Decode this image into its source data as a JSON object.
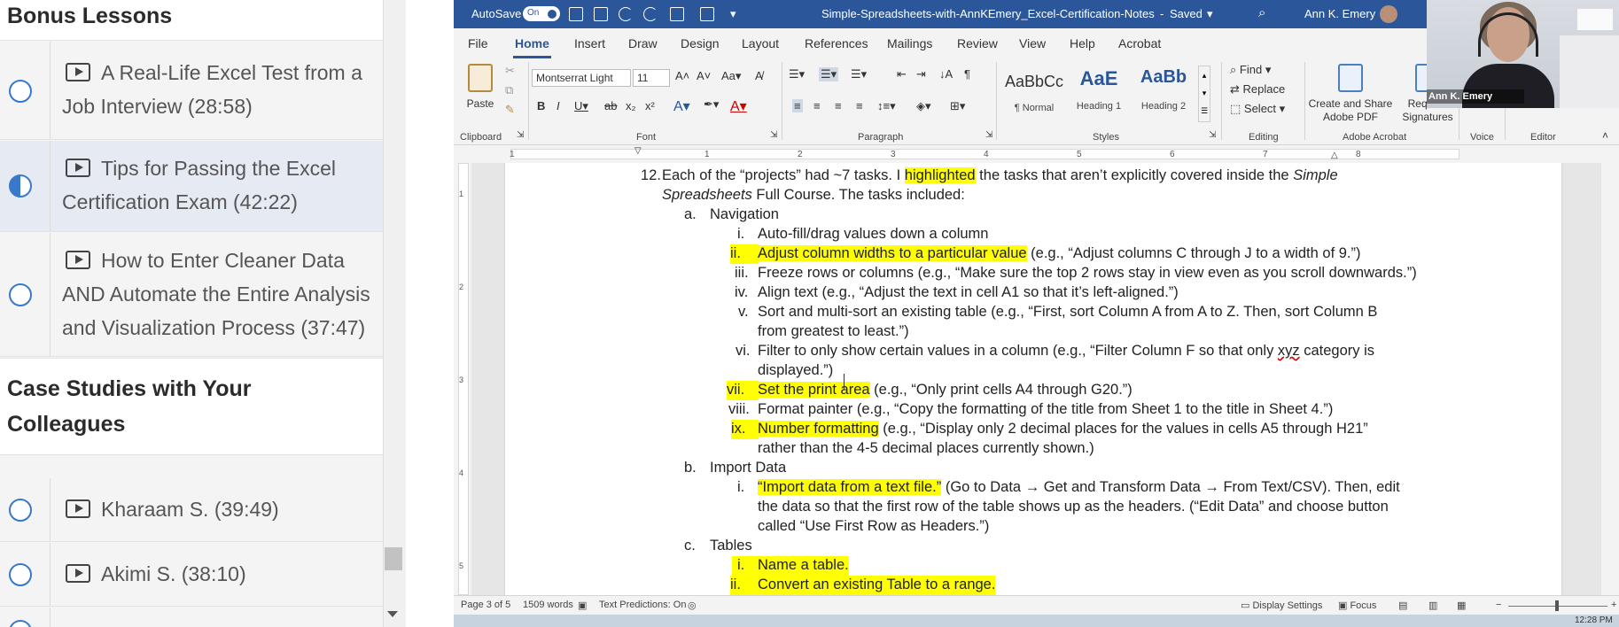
{
  "sidebar": {
    "section1_title": "Bonus Lessons",
    "lessons1": [
      {
        "l1": "A Real-Life Excel Test from a",
        "l2": "Job Interview (28:58)"
      },
      {
        "l1": "Tips for Passing the Excel",
        "l2": "Certification Exam (42:22)"
      },
      {
        "l1": "How to Enter Cleaner Data",
        "l2": "AND Automate the Entire Analysis",
        "l3": "and Visualization Process (37:47)"
      }
    ],
    "section2_title_l1": "Case Studies with Your",
    "section2_title_l2": "Colleagues",
    "lessons2": [
      {
        "l1": "Kharaam S. (39:49)"
      },
      {
        "l1": "Akimi S. (38:10)"
      }
    ]
  },
  "titlebar": {
    "autosave": "AutoSave",
    "toggle": "On",
    "doc_title": "Simple-Spreadsheets-with-AnnKEmery_Excel-Certification-Notes",
    "saved": "Saved",
    "user": "Ann K. Emery"
  },
  "menu": [
    "File",
    "Home",
    "Insert",
    "Draw",
    "Design",
    "Layout",
    "References",
    "Mailings",
    "Review",
    "View",
    "Help",
    "Acrobat"
  ],
  "ribbon": {
    "paste": "Paste",
    "font_name": "Montserrat Light",
    "font_size": "11",
    "groups": {
      "clipboard": "Clipboard",
      "font": "Font",
      "paragraph": "Paragraph",
      "styles": "Styles",
      "editing": "Editing",
      "acrobat": "Adobe Acrobat",
      "voice": "Voice",
      "editor": "Editor"
    },
    "styles": [
      {
        "preview": "AaBbCc",
        "name": "¶ Normal"
      },
      {
        "preview": "AaE",
        "name": "Heading 1"
      },
      {
        "preview": "AaBb",
        "name": "Heading 2"
      }
    ],
    "find": "Find",
    "replace": "Replace",
    "select": "Select",
    "create_share_1": "Create and Share",
    "create_share_2": "Adobe PDF",
    "request_1": "Request",
    "request_2": "Signatures"
  },
  "ruler_numbers": [
    "1",
    "1",
    "2",
    "3",
    "4",
    "5",
    "6",
    "7",
    "8"
  ],
  "vruler_numbers": [
    "1",
    "2",
    "3",
    "4",
    "5"
  ],
  "doc": {
    "item12_num": "12.",
    "item12_a": "Each of the “projects” had ~7 tasks. I ",
    "item12_hl": "highlighted",
    "item12_b": " the tasks that aren’t explicitly covered inside the ",
    "item12_it": "Simple",
    "item12_l2_it": "Spreadsheets",
    "item12_l2": " Full Course. The tasks included:",
    "a_num": "a.",
    "a_title": "Navigation",
    "nav": [
      {
        "num": "i.",
        "hl": false,
        "text": "Auto-fill/drag values down a column"
      },
      {
        "num": "ii.",
        "hl": true,
        "text": "Adjust column widths to a particular value",
        "rest": " (e.g., “Adjust columns C through J to a width of 9.”)"
      },
      {
        "num": "iii.",
        "hl": false,
        "text": "Freeze rows or columns (e.g., “Make sure the top 2 rows stay in view even as you scroll downwards.”)"
      },
      {
        "num": "iv.",
        "hl": false,
        "text": "Align text (e.g., “Adjust the text in cell A1 so that it’s left-aligned.”)"
      },
      {
        "num": "v.",
        "hl": false,
        "text": "Sort and multi-sort an existing table (e.g., “First, sort Column A from A to Z. Then, sort Column B",
        "l2": "from greatest to least.”)"
      },
      {
        "num": "vi.",
        "hl": false,
        "text": "Filter to only show certain values in a column (e.g., “Filter Column F so that only ",
        "sq": "xyz",
        "after": " category is",
        "l2": "displayed.”)"
      },
      {
        "num": "vii.",
        "hl": true,
        "text": "Set the print area",
        "rest": " (e.g., “Only print cells A4 through G20.”)"
      },
      {
        "num": "viii.",
        "hl": false,
        "text": "Format painter (e.g., “Copy the formatting of the title from Sheet 1 to the title in Sheet 4.”)"
      },
      {
        "num": "ix.",
        "hl": true,
        "text": "Number formatting",
        "rest": " (e.g., “Display only 2 decimal places for the values in cells A5 through H21”",
        "l2": "rather than the 4-5 decimal places currently shown.)"
      }
    ],
    "b_num": "b.",
    "b_title": "Import Data",
    "imp": {
      "num": "i.",
      "hl": "“Import data from a text file.”",
      "rest": " (Go to Data → Get and Transform Data → From Text/CSV). Then, edit",
      "l2": "the data so that the first row of the table shows up as the headers. (“Edit Data” and choose button",
      "l3": "called “Use First Row as Headers.”)"
    },
    "c_num": "c.",
    "c_title": "Tables",
    "tables": [
      {
        "num": "i.",
        "text": "Name a table."
      },
      {
        "num": "ii.",
        "text": "Convert an existing Table to a range."
      }
    ]
  },
  "status": {
    "page": "Page 3 of 5",
    "words": "1509 words",
    "predictions": "Text Predictions: On",
    "display": "Display Settings",
    "focus": "Focus"
  },
  "taskbar_time": "12:28 PM",
  "webcam_caption": "Ann K. Emery",
  "colors": {
    "accent": "#2b579a",
    "highlight": "#ffff00",
    "progress": "#3a78c9"
  }
}
